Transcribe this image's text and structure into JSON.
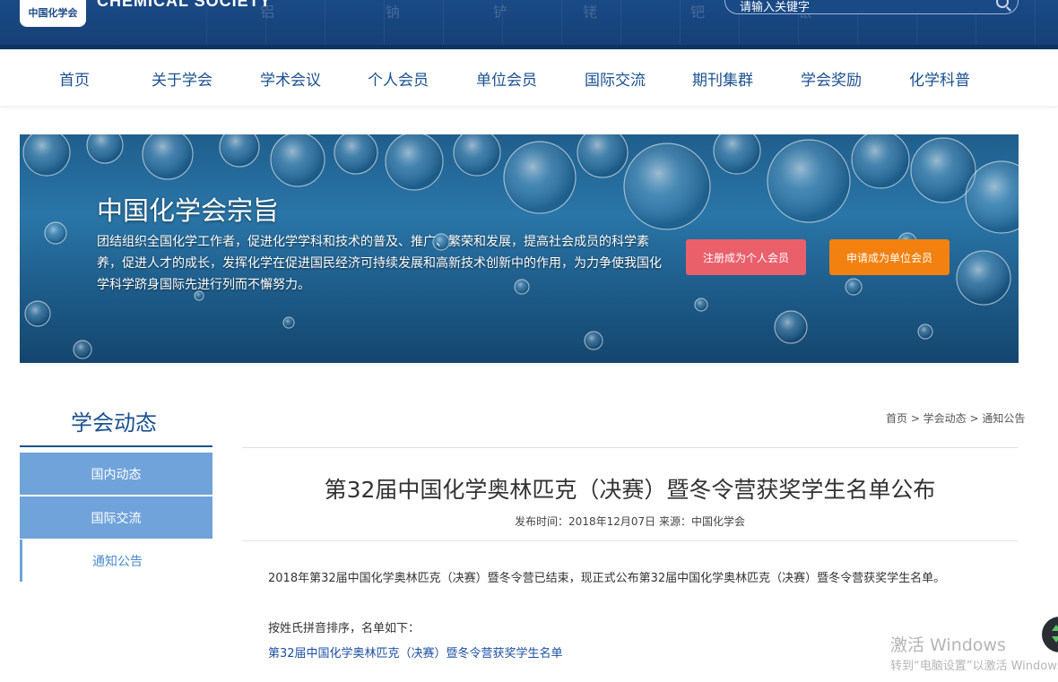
{
  "header": {
    "logo_cn": "中国化学会",
    "logo_en": "CHEMICAL SOCIETY",
    "search_placeholder": "请输入关键字",
    "pattern_glyphs": [
      "铝",
      "钠",
      "铲",
      "铑",
      "钯",
      "银"
    ]
  },
  "nav": {
    "items": [
      "首页",
      "关于学会",
      "学术会议",
      "个人会员",
      "单位会员",
      "国际交流",
      "期刊集群",
      "学会奖励",
      "化学科普"
    ]
  },
  "banner": {
    "title": "中国化学会宗旨",
    "desc": "团结组织全国化学工作者，促进化学学科和技术的普及、推广、繁荣和发展，提高社会成员的科学素养，促进人才的成长，发挥化学在促进国民经济可持续发展和高新技术创新中的作用，为力争使我国化学科学跻身国际先进行列而不懈努力。",
    "btn_personal": "注册成为个人会员",
    "btn_unit": "申请成为单位会员"
  },
  "sidebar": {
    "title": "学会动态",
    "items": [
      "国内动态",
      "国际交流",
      "通知公告"
    ]
  },
  "breadcrumb": "首页 > 学会动态 > 通知公告",
  "article": {
    "title": "第32届中国化学奥林匹克（决赛）暨冬令营获奖学生名单公布",
    "meta": "发布时间：2018年12月07日 来源：中国化学会",
    "p1": "2018年第32届中国化学奥林匹克（决赛）暨冬令营已结束，现正式公布第32届中国化学奥林匹克（决赛）暨冬令营获奖学生名单。",
    "p2": "按姓氏拼音排序，名单如下：",
    "link": "第32届中国化学奥林匹克（决赛）暨冬令营获奖学生名单"
  },
  "watermark": {
    "line1": "激活 Windows",
    "line2": "转到“电脑设置”以激活 Windows。"
  },
  "colors": {
    "brand": "#1b5190",
    "sidebar_blue": "#6fa3da",
    "btn_red": "#e9606b",
    "btn_orange": "#f2810f",
    "link": "#1b4fa3"
  }
}
